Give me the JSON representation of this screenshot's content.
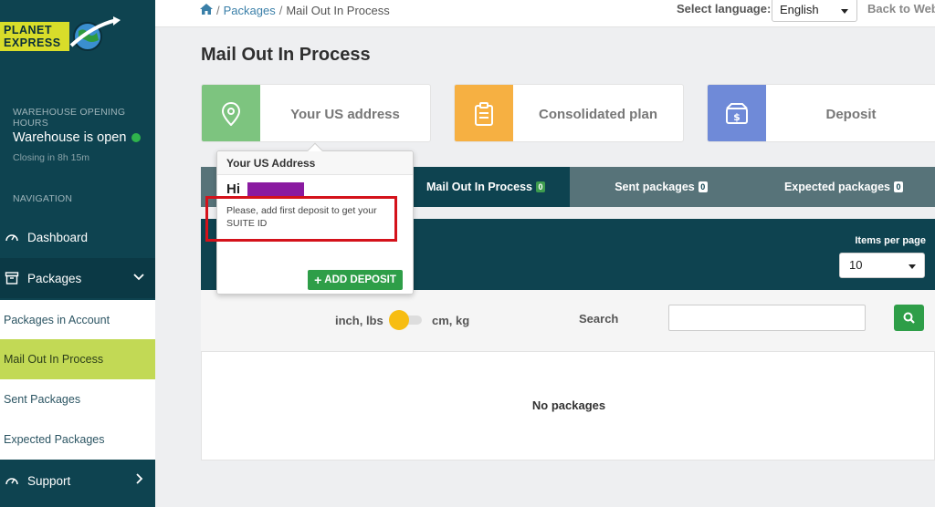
{
  "brand": {
    "logo_line1": "PLANET",
    "logo_line2": "EXPRESS"
  },
  "sidebar": {
    "hours_heading": "WAREHOUSE OPENING HOURS",
    "status": "Warehouse is open",
    "closing": "Closing in 8h 15m",
    "nav_heading": "NAVIGATION",
    "dashboard": "Dashboard",
    "packages": "Packages",
    "sub": [
      "Packages in Account",
      "Mail Out In Process",
      "Sent Packages",
      "Expected Packages"
    ],
    "support": "Support"
  },
  "topbar": {
    "crumb_packages": "Packages",
    "crumb_current": "Mail Out In Process",
    "lang_label": "Select language:",
    "lang_value": "English",
    "back_link": "Back to Web"
  },
  "page": {
    "title": "Mail Out In Process"
  },
  "cards": [
    {
      "label": "Your US address",
      "color": "#7dc47f"
    },
    {
      "label": "Consolidated plan",
      "color": "#f6b042"
    },
    {
      "label": "Deposit",
      "color": "#6f8ad8"
    }
  ],
  "tabs": [
    {
      "label": "Mail Out In Process",
      "count": "0"
    },
    {
      "label": "Sent packages",
      "count": "0"
    },
    {
      "label": "Expected packages",
      "count": "0"
    }
  ],
  "list": {
    "items_per_page_label": "Items per page",
    "items_per_page_value": "10"
  },
  "filters": {
    "unit_imperial": "inch, lbs",
    "unit_metric": "cm, kg",
    "search_label": "Search",
    "search_value": ""
  },
  "table": {
    "empty_text": "No packages"
  },
  "popover": {
    "title": "Your US Address",
    "greeting": "Hi",
    "message": "Please, add first deposit to get your SUITE ID",
    "button": "ADD DEPOSIT"
  }
}
